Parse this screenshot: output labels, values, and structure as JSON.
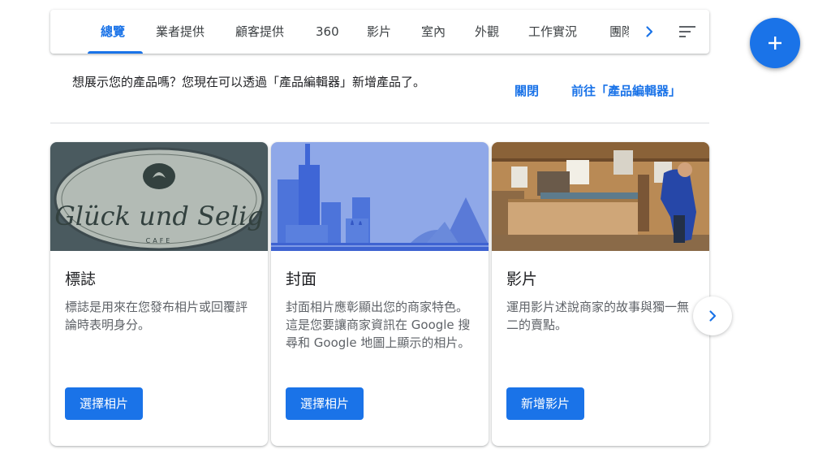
{
  "tabs": [
    {
      "label": "總覽",
      "active": true
    },
    {
      "label": "業者提供"
    },
    {
      "label": "顧客提供"
    },
    {
      "label": "360"
    },
    {
      "label": "影片"
    },
    {
      "label": "室內"
    },
    {
      "label": "外觀"
    },
    {
      "label": "工作實況"
    },
    {
      "label": "團隊"
    }
  ],
  "icons": {
    "tab_next": "chevron-right-icon",
    "sort": "sort-icon",
    "add": "plus-icon",
    "carousel_next": "chevron-right-icon"
  },
  "promo": {
    "message": "想展示您的產品嗎？您現在可以透過「產品編輯器」新增產品了。",
    "dismiss_label": "關閉",
    "goto_label": "前往「產品編輯器」"
  },
  "cards": [
    {
      "title": "標誌",
      "description": "標誌是用來在您發布相片或回覆評論時表明身分。",
      "button_label": "選擇相片",
      "image": "logo-photo"
    },
    {
      "title": "封面",
      "description": "封面相片應彰顯出您的商家特色。這是您要讓商家資訊在 Google 搜尋和 Google 地圖上顯示的相片。",
      "button_label": "選擇相片",
      "image": "cover-illustration"
    },
    {
      "title": "影片",
      "description": "運用影片述說商家的故事與獨一無二的賣點。",
      "button_label": "新增影片",
      "image": "shop-interior-photo"
    }
  ],
  "logo_text": {
    "script_line1": "Glück und Selig",
    "sub": "CAFE"
  },
  "colors": {
    "accent": "#1a73e8",
    "text": "#202124",
    "secondary_text": "#5f6368"
  }
}
